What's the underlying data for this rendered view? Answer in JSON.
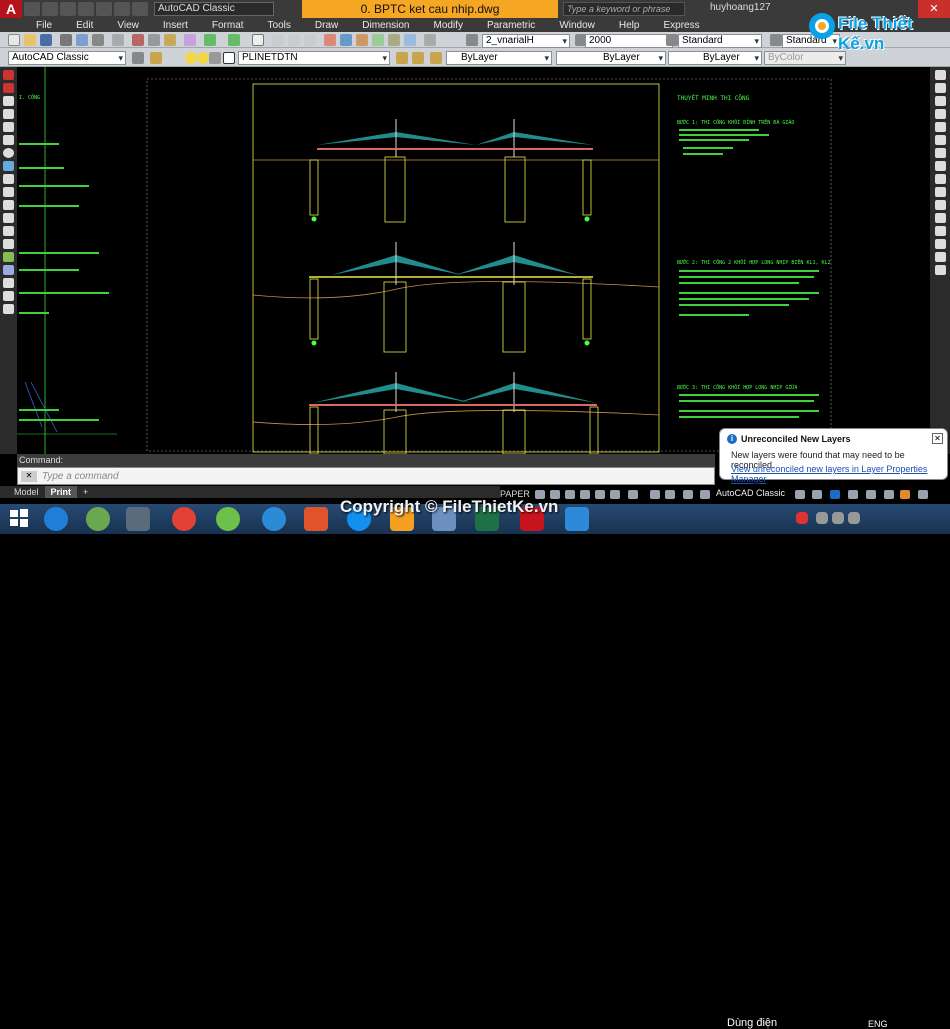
{
  "titlebar": {
    "workspace": "AutoCAD Classic",
    "document": "0. BPTC ket cau nhip.dwg",
    "search_placeholder": "Type a keyword or phrase",
    "user": "huyhoang127"
  },
  "menu": [
    "File",
    "Edit",
    "View",
    "Insert",
    "Format",
    "Tools",
    "Draw",
    "Dimension",
    "Modify",
    "Parametric",
    "Window",
    "Help",
    "Express"
  ],
  "toolbar1": {
    "text_style": "2_vnarialH",
    "text_height": "2000",
    "dim_style": "Standard",
    "table_style": "Standard"
  },
  "toolbar2": {
    "workspace": "AutoCAD Classic",
    "layer": "PLINETDTN",
    "color": "ByLayer",
    "linetype": "ByLayer",
    "lineweight": "ByLayer",
    "plotstyle": "ByColor"
  },
  "drawing": {
    "right_heading": "THUYẾT MINH THI CÔNG",
    "left_heading": "I. CÔNG",
    "right_sections": [
      "BƯỚC 1: THI CÔNG KHỐI ĐỈNH TRÊN ĐÀ GIÁO",
      "BƯỚC 2: THI CÔNG 2 KHỐI HỢP LONG NHỊP BIÊN KL1, KL2",
      "BƯỚC 3: THI CÔNG KHỐI HỢP LONG NHỊP GIỮA"
    ]
  },
  "notification": {
    "title": "Unreconciled New Layers",
    "body": "New layers were found that may need to be reconciled.",
    "link": "View unreconciled new layers in Layer Properties Manager"
  },
  "command": {
    "history_label": "Command:",
    "prompt": "Type a command"
  },
  "layout_tabs": [
    "Model",
    "Print",
    "+"
  ],
  "status": {
    "paper": "PAPER",
    "workspace": "AutoCAD Classic"
  },
  "watermark": {
    "logo_text": "File Thiết Kế.vn",
    "copyright": "Copyright © FileThietKe.vn"
  },
  "taskbar": {
    "tray_text": "Dùng điện",
    "lang": "ENG"
  },
  "colors": {
    "accent_title": "#f5a623",
    "drawing_bg": "#000000",
    "green_text": "#46ff46",
    "cyan_cable": "#2ec7c7",
    "yellow_pier": "#e9e94a"
  }
}
